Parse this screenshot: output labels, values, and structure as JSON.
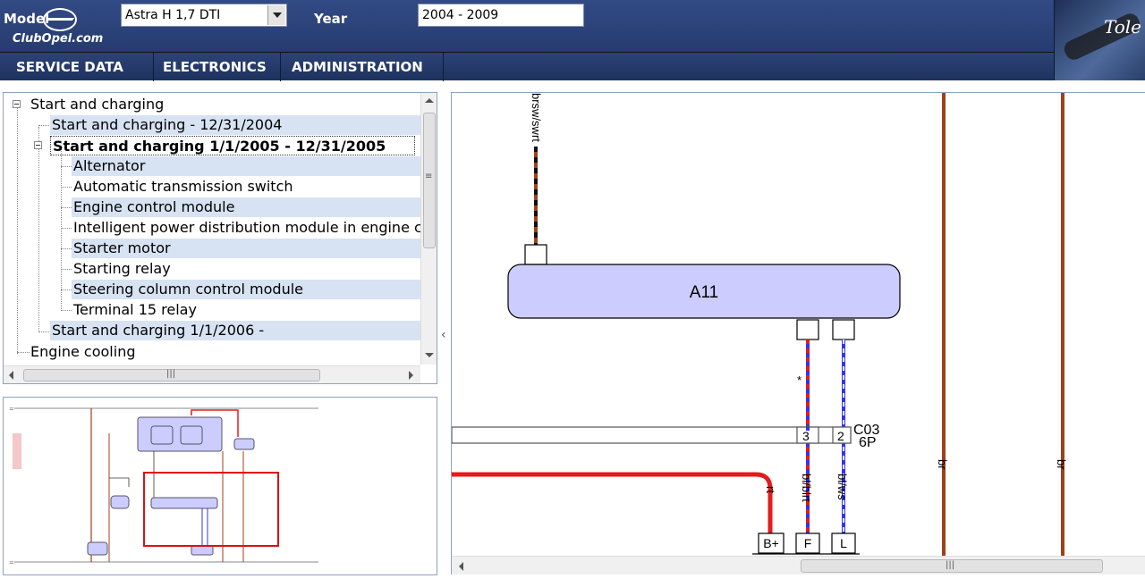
{
  "header": {
    "model_label": "Model",
    "brand_name": "ClubOpel.com",
    "model_value": "Astra H 1,7 DTI",
    "year_label": "Year",
    "year_value": "2004 - 2009",
    "corner_text": "Tole"
  },
  "nav": [
    {
      "label": "SERVICE DATA"
    },
    {
      "label": "ELECTRONICS"
    },
    {
      "label": "ADMINISTRATION"
    }
  ],
  "tree": {
    "items": [
      {
        "label": "Start and charging"
      },
      {
        "label": "Start and charging - 12/31/2004"
      },
      {
        "label": "Start and charging 1/1/2005 - 12/31/2005"
      },
      {
        "label": "Alternator"
      },
      {
        "label": "Automatic transmission switch"
      },
      {
        "label": "Engine control module"
      },
      {
        "label": "Intelligent power distribution module in engine compartment"
      },
      {
        "label": "Starter motor"
      },
      {
        "label": "Starting relay"
      },
      {
        "label": "Steering column control module"
      },
      {
        "label": "Terminal 15 relay"
      },
      {
        "label": "Start and charging 1/1/2006 -"
      },
      {
        "label": "Engine cooling"
      }
    ]
  },
  "diagram": {
    "module_label": "A11",
    "wire_top": "brsw/swrt",
    "connector_name": "C03",
    "connector_pins": "6P",
    "pin_left": "3",
    "pin_right": "2",
    "asterisk": "*",
    "wire_rt": "rt",
    "wire_blblrt": "bl/blrt",
    "wire_blws": "bl/ws",
    "wire_br1": "br",
    "wire_br2": "br",
    "terminal_b": "B+",
    "terminal_f": "F",
    "terminal_l": "L",
    "colors": {
      "module_fill": "#ccccff",
      "brown": "#a0401a",
      "red": "#e51a1a",
      "blue": "#3333ee"
    }
  }
}
